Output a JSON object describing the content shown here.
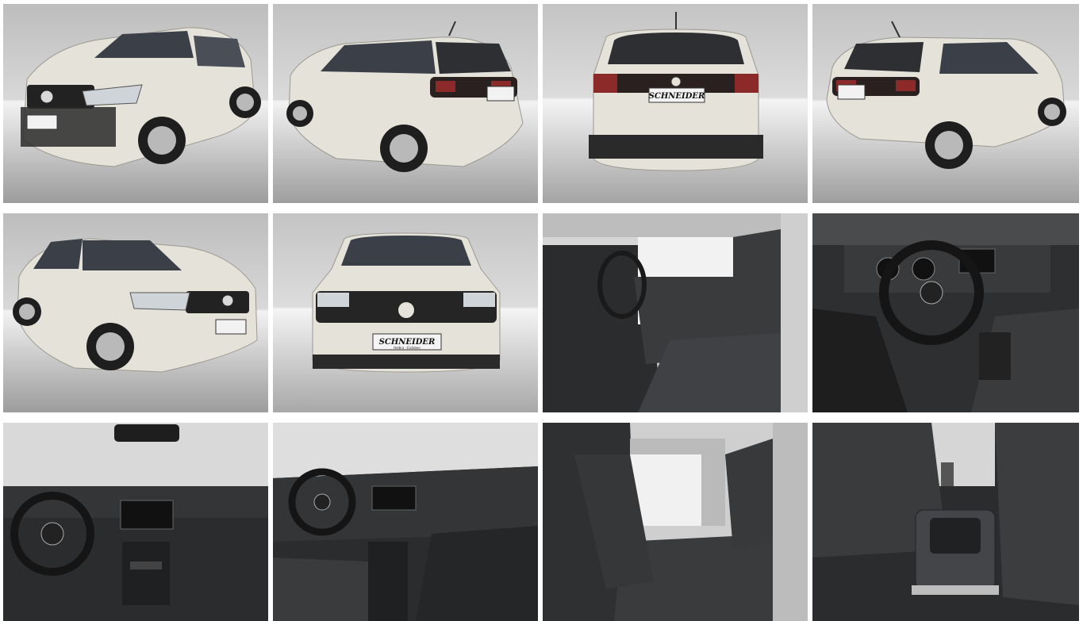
{
  "gallery": {
    "photos": [
      {
        "name": "front-left-exterior-photo"
      },
      {
        "name": "rear-left-exterior-photo"
      },
      {
        "name": "rear-exterior-photo"
      },
      {
        "name": "rear-right-exterior-photo"
      },
      {
        "name": "front-right-exterior-photo"
      },
      {
        "name": "front-exterior-photo"
      },
      {
        "name": "driver-seat-interior-photo"
      },
      {
        "name": "steering-wheel-dashboard-photo"
      },
      {
        "name": "dashboard-center-photo"
      },
      {
        "name": "dashboard-passenger-view-photo"
      },
      {
        "name": "rear-seats-photo"
      },
      {
        "name": "center-armrest-photo"
      }
    ]
  },
  "plates": {
    "dealer_main": "SCHNEIDER",
    "dealer_sub": "Helbra · Eisleben"
  },
  "colors": {
    "car_body": "#e4e2d9",
    "studio_top": "#c9c9c9",
    "studio_floor": "#ececec",
    "interior_dark": "#2e2f31",
    "seat_fabric": "#3a3b3d"
  }
}
